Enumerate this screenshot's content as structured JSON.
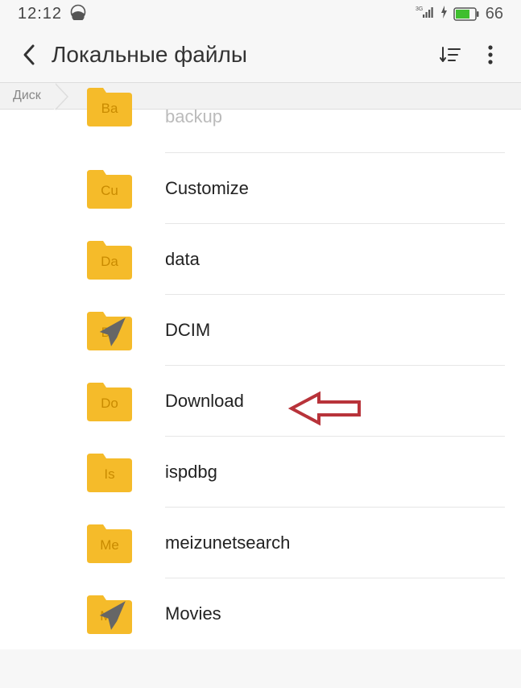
{
  "status": {
    "time": "12:12",
    "battery": "66"
  },
  "header": {
    "title": "Локальные файлы"
  },
  "breadcrumb": {
    "root": "Диск"
  },
  "folders": [
    {
      "tag": "Ba",
      "name": "backup",
      "shared": false,
      "cut": true
    },
    {
      "tag": "Cu",
      "name": "Customize",
      "shared": false,
      "cut": false
    },
    {
      "tag": "Da",
      "name": "data",
      "shared": false,
      "cut": false
    },
    {
      "tag": "Dc",
      "name": "DCIM",
      "shared": true,
      "cut": false
    },
    {
      "tag": "Do",
      "name": "Download",
      "shared": false,
      "cut": false
    },
    {
      "tag": "Is",
      "name": "ispdbg",
      "shared": false,
      "cut": false
    },
    {
      "tag": "Me",
      "name": "meizunetsearch",
      "shared": false,
      "cut": false
    },
    {
      "tag": "Mo",
      "name": "Movies",
      "shared": true,
      "cut": false
    }
  ]
}
